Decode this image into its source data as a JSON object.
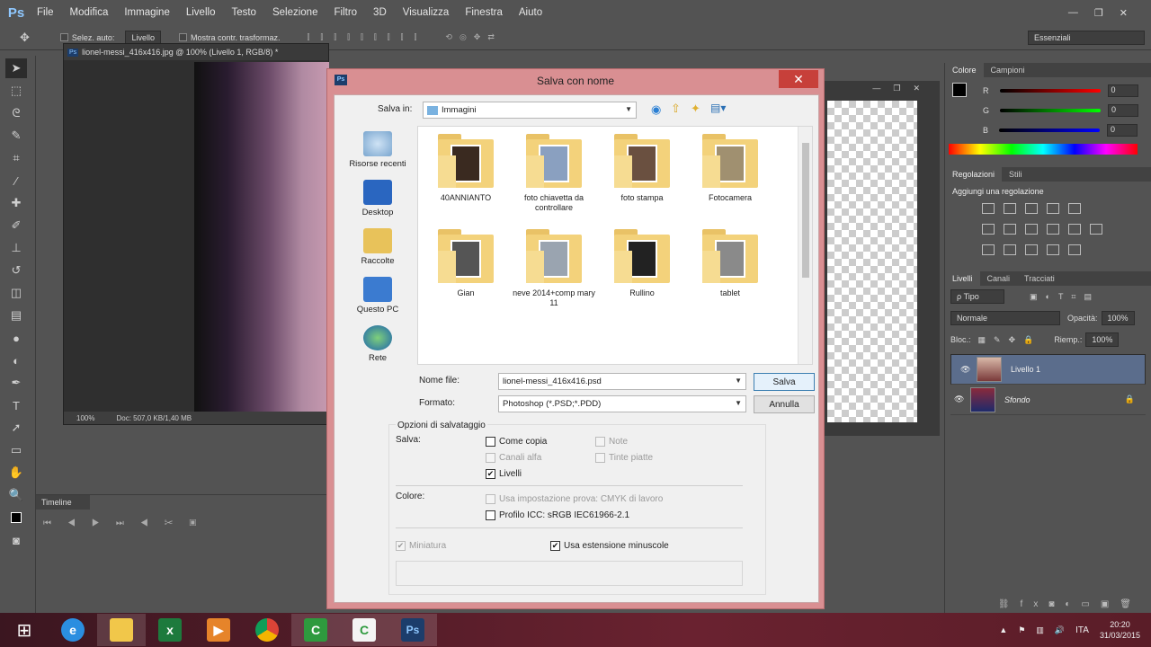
{
  "app": {
    "logo": "Ps"
  },
  "menu": [
    "File",
    "Modifica",
    "Immagine",
    "Livello",
    "Testo",
    "Selezione",
    "Filtro",
    "3D",
    "Visualizza",
    "Finestra",
    "Aiuto"
  ],
  "window_controls": {
    "min": "—",
    "restore": "❐",
    "close": "✕"
  },
  "options_bar": {
    "auto_select": "Selez. auto:",
    "auto_select_target": "Livello",
    "show_transform": "Mostra contr. trasformaz.",
    "workspace": "Essenziali"
  },
  "document": {
    "tab": "lionel-messi_416x416.jpg @ 100% (Livello 1, RGB/8) *",
    "zoom": "100%",
    "doc_info": "Doc: 507,0 KB/1,40 MB"
  },
  "timeline": {
    "title": "Timeline"
  },
  "colors_panel": {
    "tabs": [
      "Colore",
      "Campioni"
    ],
    "r_label": "R",
    "g_label": "G",
    "b_label": "B",
    "r": "0",
    "g": "0",
    "b": "0"
  },
  "adjustments_panel": {
    "tabs": [
      "Regolazioni",
      "Stili"
    ],
    "heading": "Aggiungi una regolazione"
  },
  "layers_panel": {
    "tabs": [
      "Livelli",
      "Canali",
      "Tracciati"
    ],
    "filter": "ρ Tipo",
    "blend_mode": "Normale",
    "opacity_label": "Opacità:",
    "opacity": "100%",
    "lock_label": "Bloc.:",
    "fill_label": "Riemp.:",
    "fill": "100%",
    "layers": [
      {
        "name": "Livello 1",
        "selected": true
      },
      {
        "name": "Sfondo",
        "selected": false
      }
    ]
  },
  "dialog": {
    "title": "Salva con nome",
    "close": "✕",
    "save_in_label": "Salva in:",
    "save_in_value": "Immagini",
    "nav": [
      "Risorse recenti",
      "Desktop",
      "Raccolte",
      "Questo PC",
      "Rete"
    ],
    "folders": [
      {
        "name": "40ANNIANTO"
      },
      {
        "name": "foto chiavetta da controllare"
      },
      {
        "name": "foto stampa"
      },
      {
        "name": "Fotocamera"
      },
      {
        "name": "Gian"
      },
      {
        "name": "neve 2014+comp mary 11"
      },
      {
        "name": "Rullino"
      },
      {
        "name": "tablet"
      }
    ],
    "filename_label": "Nome file:",
    "filename": "lionel-messi_416x416.psd",
    "format_label": "Formato:",
    "format": "Photoshop (*.PSD;*.PDD)",
    "save_button": "Salva",
    "cancel_button": "Annulla",
    "options_title": "Opzioni di salvataggio",
    "save_label": "Salva:",
    "opt_as_copy": "Come copia",
    "opt_notes": "Note",
    "opt_alpha": "Canali alfa",
    "opt_spot": "Tinte piatte",
    "opt_layers": "Livelli",
    "color_label": "Colore:",
    "opt_proof": "Usa impostazione prova:  CMYK di lavoro",
    "opt_icc": "Profilo ICC:  sRGB IEC61966-2.1",
    "opt_thumb": "Miniatura",
    "opt_lowercase": "Usa estensione minuscole"
  },
  "taskbar": {
    "apps": [
      "windows-start",
      "internet-explorer",
      "file-explorer",
      "excel",
      "media-player",
      "chrome",
      "camtasia",
      "camtasia-recorder",
      "photoshop"
    ]
  },
  "tray": {
    "lang": "ITA",
    "time": "20:20",
    "date": "31/03/2015"
  }
}
